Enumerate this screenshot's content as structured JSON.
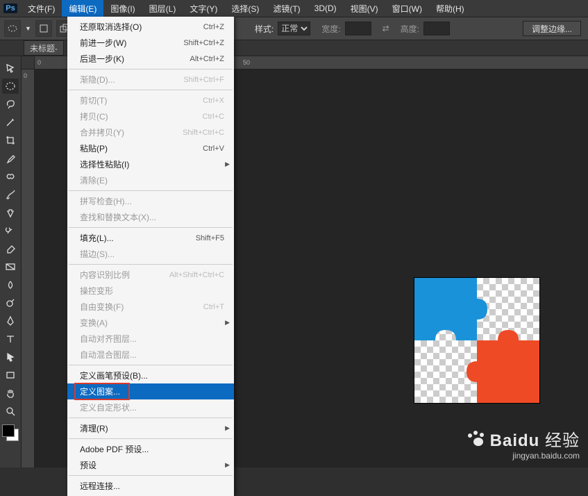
{
  "app": {
    "logo": "Ps"
  },
  "menubar": [
    {
      "id": "file",
      "label": "文件(F)"
    },
    {
      "id": "edit",
      "label": "编辑(E)",
      "open": true
    },
    {
      "id": "image",
      "label": "图像(I)"
    },
    {
      "id": "layer",
      "label": "图层(L)"
    },
    {
      "id": "type",
      "label": "文字(Y)"
    },
    {
      "id": "select",
      "label": "选择(S)"
    },
    {
      "id": "filter",
      "label": "滤镜(T)"
    },
    {
      "id": "3d",
      "label": "3D(D)"
    },
    {
      "id": "view",
      "label": "视图(V)"
    },
    {
      "id": "window",
      "label": "窗口(W)"
    },
    {
      "id": "help",
      "label": "帮助(H)"
    }
  ],
  "options": {
    "mode_label": "样式:",
    "mode_value": "正常",
    "width_label": "宽度:",
    "swap_icon": "⇄",
    "height_label": "高度:",
    "adjust_button": "调整边缘..."
  },
  "doc_tab": "未标题-",
  "edit_menu": [
    {
      "label": "还原取消选择(O)",
      "shortcut": "Ctrl+Z"
    },
    {
      "label": "前进一步(W)",
      "shortcut": "Shift+Ctrl+Z"
    },
    {
      "label": "后退一步(K)",
      "shortcut": "Alt+Ctrl+Z"
    },
    {
      "sep": true
    },
    {
      "label": "渐隐(D)...",
      "shortcut": "Shift+Ctrl+F",
      "disabled": true
    },
    {
      "sep": true
    },
    {
      "label": "剪切(T)",
      "shortcut": "Ctrl+X",
      "disabled": true
    },
    {
      "label": "拷贝(C)",
      "shortcut": "Ctrl+C",
      "disabled": true
    },
    {
      "label": "合并拷贝(Y)",
      "shortcut": "Shift+Ctrl+C",
      "disabled": true
    },
    {
      "label": "粘贴(P)",
      "shortcut": "Ctrl+V"
    },
    {
      "label": "选择性粘贴(I)",
      "submenu": true
    },
    {
      "label": "清除(E)",
      "disabled": true
    },
    {
      "sep": true
    },
    {
      "label": "拼写检查(H)...",
      "disabled": true
    },
    {
      "label": "查找和替换文本(X)...",
      "disabled": true
    },
    {
      "sep": true
    },
    {
      "label": "填充(L)...",
      "shortcut": "Shift+F5"
    },
    {
      "label": "描边(S)...",
      "disabled": true
    },
    {
      "sep": true
    },
    {
      "label": "内容识别比例",
      "shortcut": "Alt+Shift+Ctrl+C",
      "disabled": true
    },
    {
      "label": "操控变形",
      "disabled": true
    },
    {
      "label": "自由变换(F)",
      "shortcut": "Ctrl+T",
      "disabled": true
    },
    {
      "label": "变换(A)",
      "submenu": true,
      "disabled": true
    },
    {
      "label": "自动对齐图层...",
      "disabled": true
    },
    {
      "label": "自动混合图层...",
      "disabled": true
    },
    {
      "sep": true
    },
    {
      "label": "定义画笔预设(B)..."
    },
    {
      "label": "定义图案...",
      "highlight": true,
      "boxed": true
    },
    {
      "label": "定义自定形状...",
      "disabled": true
    },
    {
      "sep": true
    },
    {
      "label": "清理(R)",
      "submenu": true
    },
    {
      "sep": true
    },
    {
      "label": "Adobe PDF 预设..."
    },
    {
      "label": "预设",
      "submenu": true
    },
    {
      "sep": true
    },
    {
      "label": "远程连接..."
    }
  ],
  "ruler_h_ticks": [
    "0",
    "50"
  ],
  "ruler_v_ticks": [
    "0"
  ],
  "puzzle": {
    "color_tl": "#1992d9",
    "color_br": "#ee4a26"
  },
  "watermark": {
    "brand": "Baidu",
    "suffix": "经验",
    "sub": "jingyan.baidu.com"
  },
  "tool_names": [
    "move",
    "rect-marquee",
    "lasso",
    "magic-wand",
    "crop",
    "eyedropper",
    "healing",
    "brush",
    "clone",
    "history-brush",
    "eraser",
    "gradient",
    "blur",
    "dodge",
    "pen",
    "type",
    "path-select",
    "rectangle",
    "hand",
    "zoom"
  ]
}
